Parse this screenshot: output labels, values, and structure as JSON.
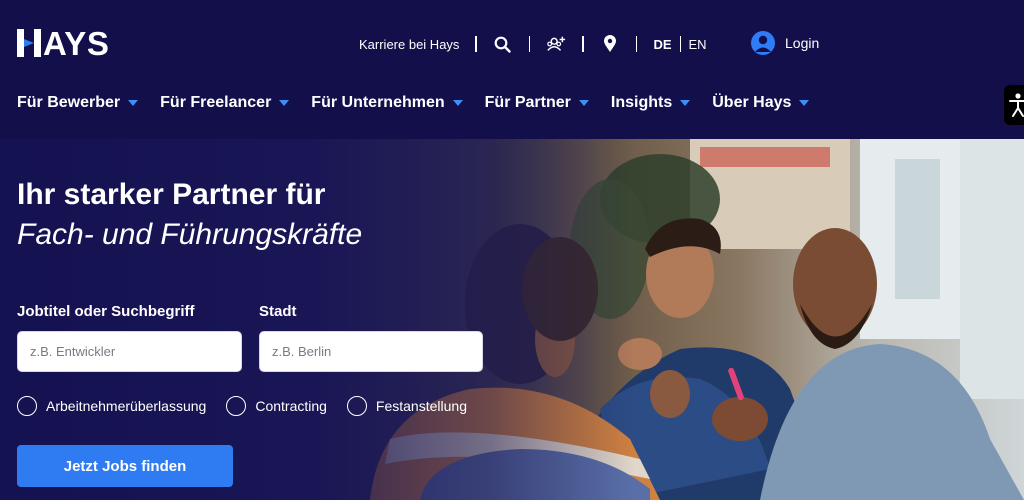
{
  "brand": {
    "name": "HAYS",
    "accent": "#2f7bf2",
    "nav_bg": "#120f4a"
  },
  "topbar": {
    "career_link": "Karriere bei Hays",
    "icons": [
      "search-icon",
      "people-add-icon",
      "location-pin-icon"
    ],
    "lang_de": "DE",
    "lang_en": "EN",
    "login": "Login"
  },
  "nav": {
    "items": [
      {
        "label": "Für Bewerber"
      },
      {
        "label": "Für Freelancer"
      },
      {
        "label": "Für Unternehmen"
      },
      {
        "label": "Für Partner"
      },
      {
        "label": "Insights"
      },
      {
        "label": "Über Hays"
      }
    ]
  },
  "hero": {
    "title_line1": "Ihr starker Partner für",
    "title_line2": "Fach- und Führungskräfte"
  },
  "search": {
    "job_label": "Jobtitel oder Suchbegriff",
    "job_placeholder": "z.B. Entwickler",
    "city_label": "Stadt",
    "city_placeholder": "z.B. Berlin",
    "options": [
      {
        "label": "Arbeitnehmerüberlassung"
      },
      {
        "label": "Contracting"
      },
      {
        "label": "Festanstellung"
      }
    ],
    "submit": "Jetzt Jobs finden"
  }
}
